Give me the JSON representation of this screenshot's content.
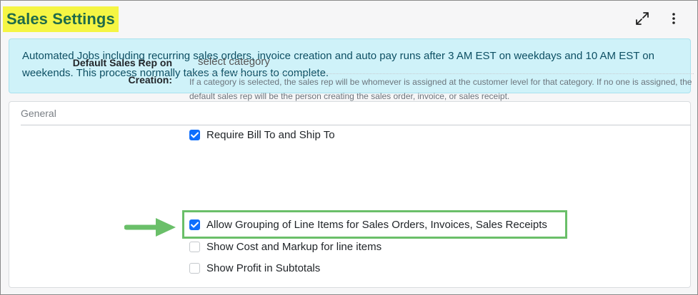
{
  "header": {
    "title": "Sales Settings",
    "icons": [
      "expand-icon",
      "more-vertical-icon"
    ]
  },
  "alert": {
    "text": "Automated Jobs including recurring sales orders, invoice creation and auto pay runs after 3 AM EST on weekdays and 10 AM EST on weekends. This process normally takes a few hours to complete."
  },
  "general": {
    "header": "General",
    "require_bill_ship": {
      "label": "Require Bill To and Ship To",
      "checked": true
    },
    "default_sales_rep": {
      "label_line1": "Default Sales Rep on",
      "label_line2": "Creation:",
      "placeholder": "select category",
      "help": "If a category is selected, the sales rep will be whomever is assigned at the customer level for that category. If no one is assigned, the default sales rep will be the person creating the sales order, invoice, or sales receipt."
    },
    "allow_grouping": {
      "label": "Allow Grouping of Line Items for Sales Orders, Invoices, Sales Receipts",
      "checked": true
    },
    "show_cost_markup": {
      "label": "Show Cost and Markup for line items",
      "checked": false
    },
    "show_profit": {
      "label": "Show Profit in Subtotals",
      "checked": false
    }
  },
  "colors": {
    "title_highlight": "#f5f543",
    "title_text": "#1f6b4a",
    "alert_bg": "#cff2f9",
    "checkbox_checked": "#0d6efd",
    "annotation_green": "#6abf69"
  }
}
